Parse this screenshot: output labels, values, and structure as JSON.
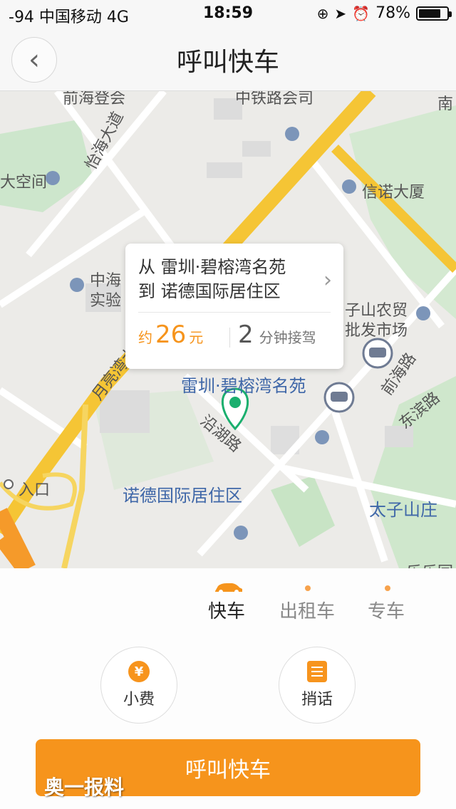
{
  "status_bar": {
    "carrier": "-94 中国移动  4G",
    "time": "18:59",
    "battery_text": "78%",
    "battery_level": 0.78,
    "icons": [
      "orientation-lock-icon",
      "location-arrow-icon",
      "alarm-icon"
    ]
  },
  "nav": {
    "back_icon": "‹",
    "title": "呼叫快车"
  },
  "map": {
    "labels": {
      "qianhai": "前海登会",
      "railway": "中铁路会司",
      "nan": "南",
      "yihai": "怡海大道",
      "space": "大空间",
      "xinnuo": "信诺大厦",
      "zhonghai": "中海",
      "shiyan": "实验",
      "yueliangwan": "月亮湾大道",
      "zishan": "子山农贸",
      "pifa": "批发市场",
      "qianhai_rd": "前海路",
      "dongbin": "东滨路",
      "leizhen": "雷圳·碧榕湾名苑",
      "yanhu": "沿湖路",
      "entrance": "入口",
      "nuode": "诺德国际居住区",
      "taizishanzhuang": "太子山庄",
      "leyue": "乐乐园"
    }
  },
  "card": {
    "route_from": "从 雷圳·碧榕湾名苑",
    "route_to": "到 诺德国际居住区",
    "arrow": "›",
    "price_prefix": "约",
    "price_value": "26",
    "price_unit": "元",
    "eta_value": "2",
    "eta_text": "分钟接驾"
  },
  "tabs": [
    {
      "label": "快车",
      "active": true
    },
    {
      "label": "出租车",
      "active": false
    },
    {
      "label": "专车",
      "active": false
    }
  ],
  "actions": {
    "tip_icon": "¥",
    "tip_label": "小费",
    "message_label": "捎话"
  },
  "call_button": "呼叫快车",
  "watermark": "奥一报料",
  "colors": {
    "accent": "#f6941c",
    "road_main": "#f5c535",
    "pin_green": "#1aaf6e",
    "poi_blue": "#3f67a8"
  }
}
